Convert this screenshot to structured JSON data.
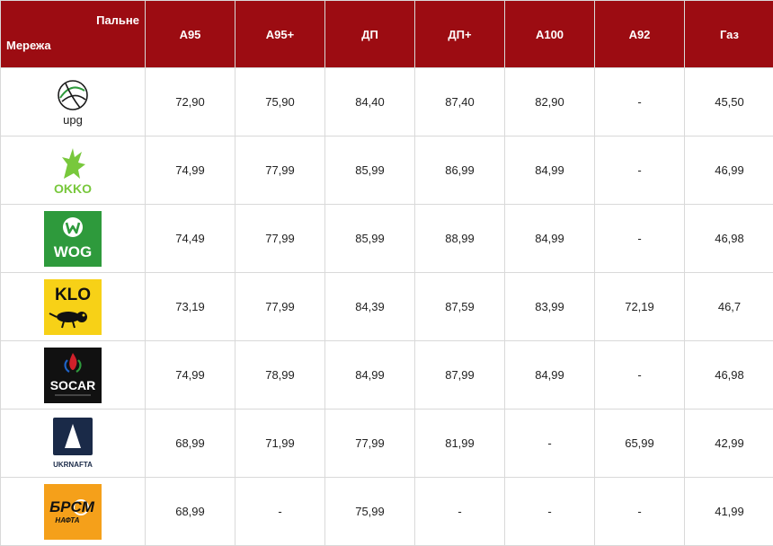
{
  "header": {
    "fuel_label": "Пальне",
    "network_label": "Мережа",
    "columns": [
      "А95",
      "А95+",
      "ДП",
      "ДП+",
      "А100",
      "А92",
      "Газ"
    ]
  },
  "rows": [
    {
      "brand": "upg",
      "logo_icon": "upg-logo-icon",
      "prices": [
        "72,90",
        "75,90",
        "84,40",
        "87,40",
        "82,90",
        "-",
        "45,50"
      ]
    },
    {
      "brand": "OKKO",
      "logo_icon": "okko-logo-icon",
      "prices": [
        "74,99",
        "77,99",
        "85,99",
        "86,99",
        "84,99",
        "-",
        "46,99"
      ]
    },
    {
      "brand": "WOG",
      "logo_icon": "wog-logo-icon",
      "prices": [
        "74,49",
        "77,99",
        "85,99",
        "88,99",
        "84,99",
        "-",
        "46,98"
      ]
    },
    {
      "brand": "KLO",
      "logo_icon": "klo-logo-icon",
      "prices": [
        "73,19",
        "77,99",
        "84,39",
        "87,59",
        "83,99",
        "72,19",
        "46,7"
      ]
    },
    {
      "brand": "SOCAR",
      "logo_icon": "socar-logo-icon",
      "prices": [
        "74,99",
        "78,99",
        "84,99",
        "87,99",
        "84,99",
        "-",
        "46,98"
      ]
    },
    {
      "brand": "UKRNAFTA",
      "logo_icon": "ukrnafta-logo-icon",
      "prices": [
        "68,99",
        "71,99",
        "77,99",
        "81,99",
        "-",
        "65,99",
        "42,99"
      ]
    },
    {
      "brand": "БРСМ НАФТА",
      "logo_icon": "brsm-logo-icon",
      "prices": [
        "68,99",
        "-",
        "75,99",
        "-",
        "-",
        "-",
        "41,99"
      ]
    }
  ],
  "colors": {
    "header_bg": "#9c0c12",
    "okko_green": "#78c83c",
    "wog_green": "#2e9a3c",
    "klo_yellow": "#f7d117",
    "brsm_orange": "#f5a01a",
    "ukrnafta_navy": "#1a2a48"
  }
}
